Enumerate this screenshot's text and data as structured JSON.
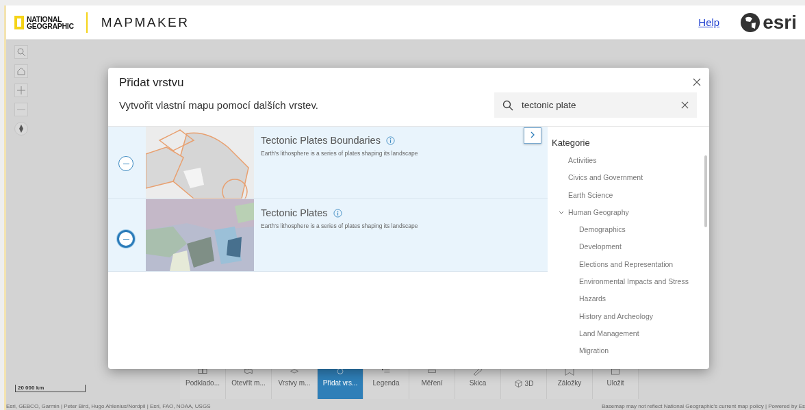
{
  "header": {
    "brand_top": "NATIONAL",
    "brand_bottom": "GEOGRAPHIC",
    "app_title": "MAPMAKER",
    "help_link": "Help",
    "esri_logo": "esri"
  },
  "map_controls": [
    {
      "kind": "search"
    },
    {
      "kind": "home"
    },
    {
      "kind": "zoom-in"
    },
    {
      "kind": "zoom-out"
    },
    {
      "kind": "compass"
    }
  ],
  "dialog": {
    "title": "Přidat vrstvu",
    "subtitle": "Vytvořit vlastní mapu pomocí dalších vrstev.",
    "search": {
      "value": "tectonic plate"
    },
    "results": [
      {
        "title": "Tectonic Plates Boundaries",
        "description": "Earth's lithosphere is a series of plates shaping its landscape",
        "selected": false
      },
      {
        "title": "Tectonic Plates",
        "description": "Earth's lithosphere is a series of plates shaping its landscape",
        "selected": true
      }
    ],
    "categories_title": "Kategorie",
    "categories": [
      {
        "label": "Activities",
        "expanded": false
      },
      {
        "label": "Civics and Government",
        "expanded": false
      },
      {
        "label": "Earth Science",
        "expanded": false
      },
      {
        "label": "Human Geography",
        "expanded": true,
        "children": [
          {
            "label": "Demographics"
          },
          {
            "label": "Development"
          },
          {
            "label": "Elections and Representation"
          },
          {
            "label": "Environmental Impacts and Stress"
          },
          {
            "label": "Hazards"
          },
          {
            "label": "History and Archeology"
          },
          {
            "label": "Land Management"
          },
          {
            "label": "Migration"
          }
        ]
      }
    ]
  },
  "toolbar": [
    {
      "label": "Podklado...",
      "kind": "basemap",
      "selected": false
    },
    {
      "label": "Otevřít m...",
      "kind": "map",
      "selected": false
    },
    {
      "label": "Vrstvy m...",
      "kind": "layers",
      "selected": false
    },
    {
      "label": "Přidat vrs...",
      "kind": "add",
      "selected": true
    },
    {
      "label": "Legenda",
      "kind": "legend",
      "selected": false
    },
    {
      "label": "Měření",
      "kind": "ruler",
      "selected": false
    },
    {
      "label": "Skica",
      "kind": "pencil",
      "selected": false
    },
    {
      "label": "3D",
      "kind": "cube",
      "selected": false
    },
    {
      "label": "Záložky",
      "kind": "bookmark",
      "selected": false
    },
    {
      "label": "Uložit",
      "kind": "save",
      "selected": false
    }
  ],
  "scale_bar": "20 000 km",
  "attribution_left": "Esri, GEBCO, Garmin | Peter Bird, Hugo Ahlenius/Nordpil | Esri, FAO, NOAA, USGS",
  "attribution_right": "Basemap may not reflect National Geographic's current map policy | Powered by Es"
}
